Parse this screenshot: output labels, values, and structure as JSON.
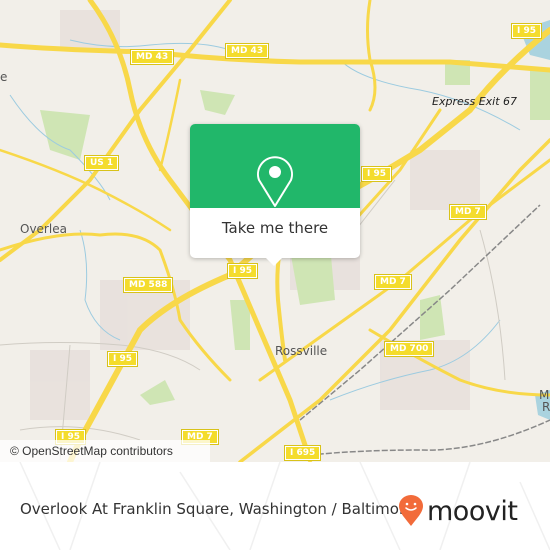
{
  "map": {
    "attribution": "© OpenStreetMap contributors",
    "place_labels": [
      {
        "id": "overlea",
        "text": "Overlea"
      },
      {
        "id": "rossville",
        "text": "Rossville"
      },
      {
        "id": "express-exit",
        "text": "Express Exit 67"
      },
      {
        "id": "edge-left",
        "text": "e"
      },
      {
        "id": "edge-right-1",
        "text": "M"
      },
      {
        "id": "edge-right-2",
        "text": "R"
      }
    ],
    "road_shields": [
      {
        "id": "md43-a",
        "text": "MD 43"
      },
      {
        "id": "md43-b",
        "text": "MD 43"
      },
      {
        "id": "i95-top",
        "text": "I 95"
      },
      {
        "id": "us1",
        "text": "US 1"
      },
      {
        "id": "i95-mid",
        "text": "I 95"
      },
      {
        "id": "md7-a",
        "text": "MD 7"
      },
      {
        "id": "md588",
        "text": "MD 588"
      },
      {
        "id": "i95-popup",
        "text": "I 95"
      },
      {
        "id": "md7-b",
        "text": "MD 7"
      },
      {
        "id": "i95-left",
        "text": "I 95"
      },
      {
        "id": "md700",
        "text": "MD 700"
      },
      {
        "id": "i95-bottom",
        "text": "I 95"
      },
      {
        "id": "md7-c",
        "text": "MD 7"
      },
      {
        "id": "i695",
        "text": "I 695"
      }
    ]
  },
  "popup": {
    "icon": "map-pin-icon",
    "button_label": "Take me there"
  },
  "footer": {
    "title": "Overlook At Franklin Square, Washington / Baltimore",
    "brand": "moovit",
    "brand_color": "#f26b3a",
    "accent_color": "#21b76a"
  }
}
